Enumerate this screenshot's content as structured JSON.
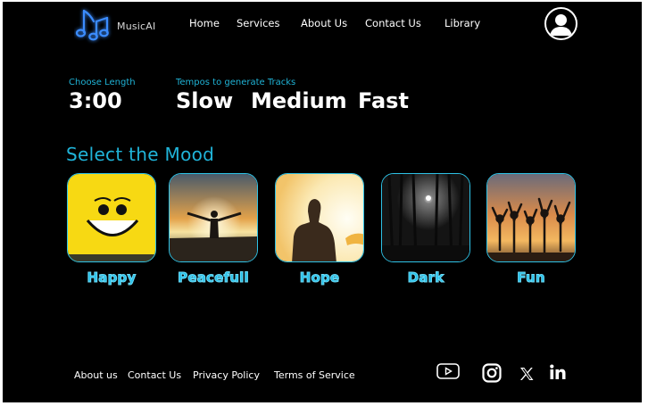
{
  "brand": {
    "name": "MusicAI",
    "accent": "#20b4d9",
    "background": "#000000"
  },
  "nav": {
    "items": [
      {
        "label": "Home"
      },
      {
        "label": "Services"
      },
      {
        "label": "About Us"
      },
      {
        "label": "Contact Us"
      },
      {
        "label": "Library"
      }
    ],
    "avatar_icon": "user-avatar-icon"
  },
  "settings": {
    "length_label": "Choose Length",
    "length_value": "3:00",
    "tempo_label": "Tempos to generate Tracks",
    "tempos": [
      "Slow",
      "Medium",
      "Fast"
    ]
  },
  "mood": {
    "heading": "Select the Mood",
    "options": [
      {
        "label": "Happy",
        "image": "smiley-face"
      },
      {
        "label": "Peacefull",
        "image": "sunset-open-arms"
      },
      {
        "label": "Hope",
        "image": "person-in-sunlight"
      },
      {
        "label": "Dark",
        "image": "dark-forest-moon"
      },
      {
        "label": "Fun",
        "image": "party-silhouettes-sunset"
      }
    ]
  },
  "footer": {
    "links": [
      "About us",
      "Contact Us",
      "Privacy Policy",
      "Terms of Service"
    ],
    "social": [
      "youtube-icon",
      "instagram-icon",
      "x-icon",
      "linkedin-icon"
    ]
  }
}
